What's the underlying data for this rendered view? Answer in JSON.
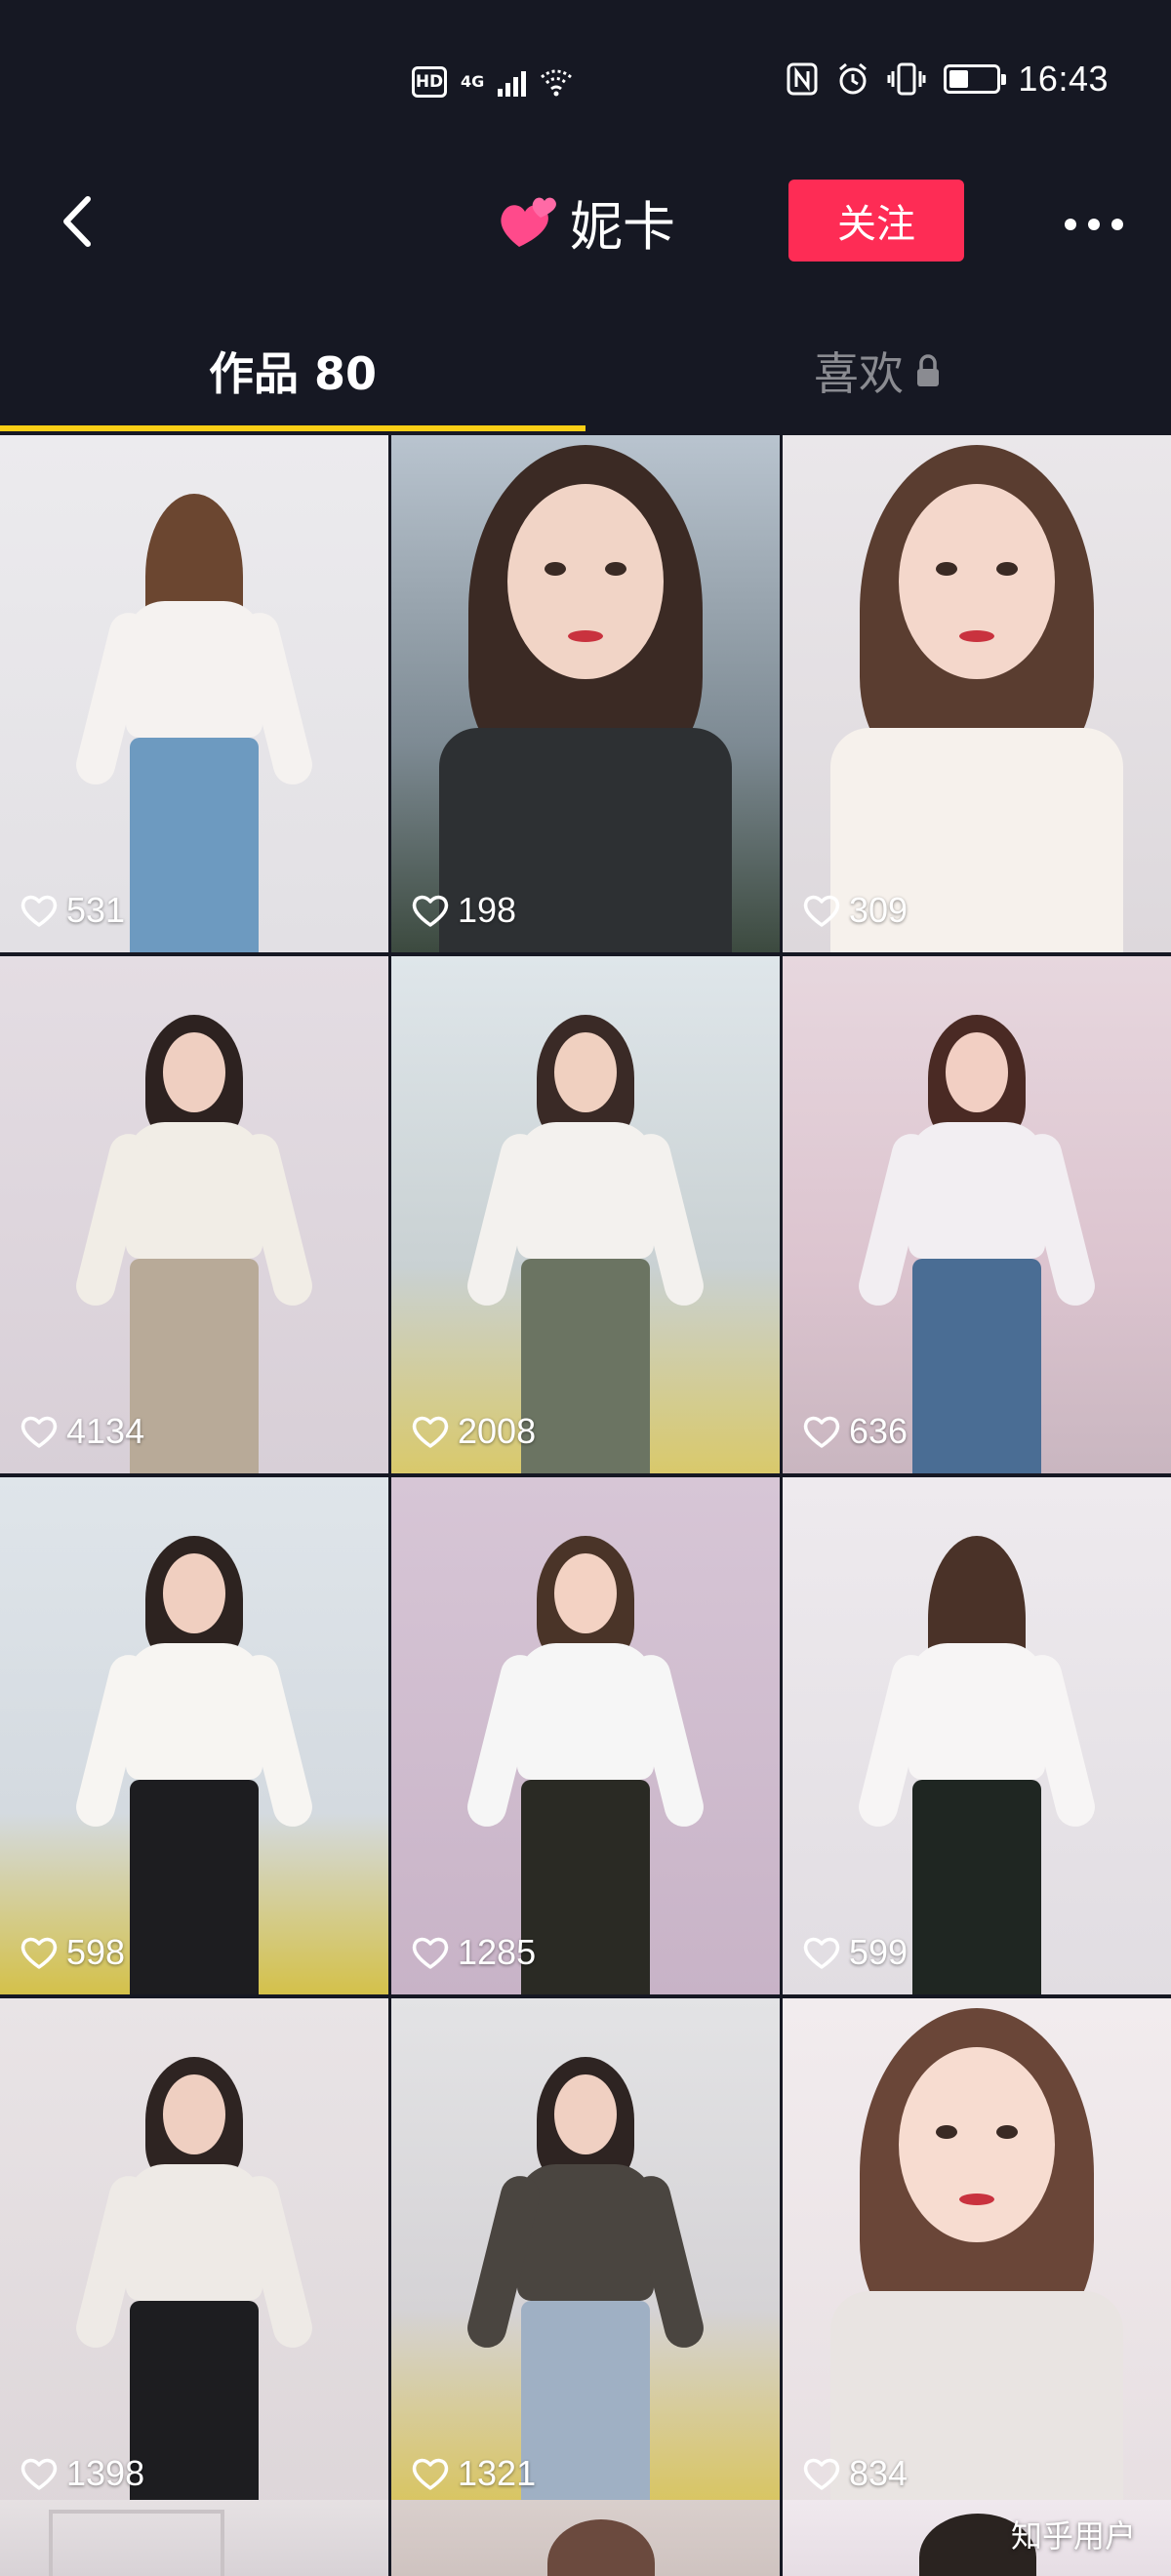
{
  "status_bar": {
    "hd_label": "HD",
    "network_label": "4G",
    "time": "16:43",
    "battery_level_percent": 40,
    "icons": [
      "hd-icon",
      "signal-icon",
      "wifi-icon",
      "nfc-icon",
      "alarm-icon",
      "vibrate-icon",
      "battery-icon"
    ]
  },
  "header": {
    "back_icon": "chevron-left-icon",
    "title_emoji": "💕",
    "title": "妮卡",
    "follow_label": "关注",
    "more_icon": "more-dots-icon"
  },
  "tabs": {
    "works_label": "作品 80",
    "likes_label": "喜欢",
    "likes_icon": "lock-icon",
    "active": "works",
    "indicator_color": "#face15"
  },
  "videos": [
    {
      "likes": "531"
    },
    {
      "likes": "198"
    },
    {
      "likes": "309"
    },
    {
      "likes": "4134"
    },
    {
      "likes": "2008"
    },
    {
      "likes": "636"
    },
    {
      "likes": "598"
    },
    {
      "likes": "1285"
    },
    {
      "likes": "599"
    },
    {
      "likes": "1398"
    },
    {
      "likes": "1321"
    },
    {
      "likes": "834"
    }
  ],
  "watermark": "知乎用户",
  "colors": {
    "background": "#161823",
    "follow_button": "#fe2c55",
    "tab_inactive": "#8a8b91"
  }
}
